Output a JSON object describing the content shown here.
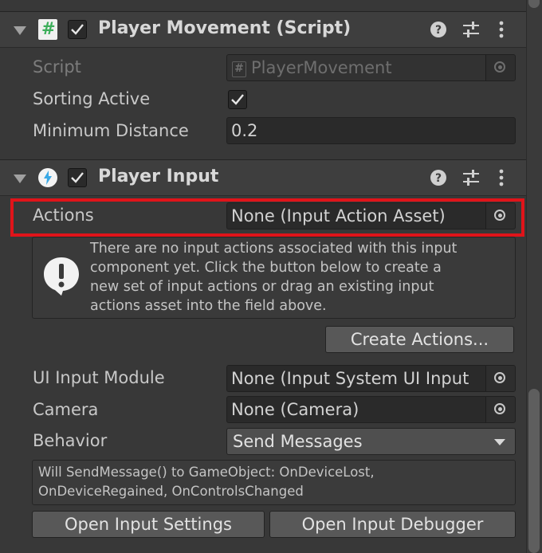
{
  "player_movement": {
    "title": "Player Movement (Script)",
    "script_label": "Script",
    "script_value": "PlayerMovement",
    "sorting_label": "Sorting Active",
    "sorting_checked": true,
    "min_distance_label": "Minimum Distance",
    "min_distance_value": "0.2"
  },
  "player_input": {
    "title": "Player Input",
    "actions_label": "Actions",
    "actions_value": "None (Input Action Asset)",
    "help_lines": [
      "There are no input actions associated with this input",
      "component yet. Click the button below to create a",
      "new set of input actions or drag an existing input",
      "actions asset into the field above."
    ],
    "create_actions_label": "Create Actions...",
    "ui_input_module_label": "UI Input Module",
    "ui_input_module_value": "None (Input System UI Input",
    "camera_label": "Camera",
    "camera_value": "None (Camera)",
    "behavior_label": "Behavior",
    "behavior_value": "Send Messages",
    "info_lines": [
      "Will SendMessage() to GameObject: OnDeviceLost,",
      "OnDeviceRegained, OnControlsChanged"
    ],
    "open_settings_label": "Open Input Settings",
    "open_debugger_label": "Open Input Debugger"
  },
  "icons": {
    "script_glyph": "#",
    "help_glyph": "?",
    "alert_glyph": "!"
  },
  "colors": {
    "highlight": "#e0141a",
    "script_icon": "#3cae5a",
    "input_icon": "#3aa9e6"
  }
}
